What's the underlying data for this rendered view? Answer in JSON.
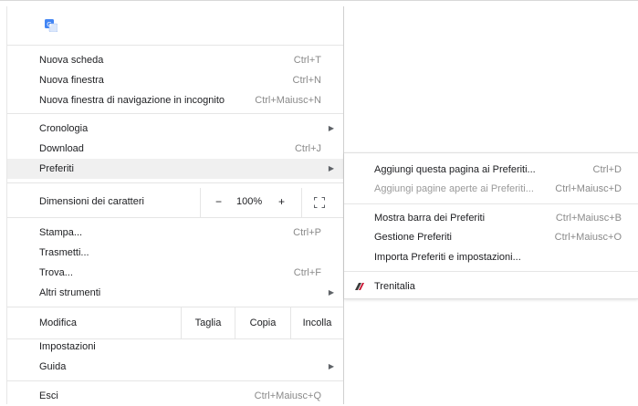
{
  "menu": {
    "new_tab": {
      "label": "Nuova scheda",
      "shortcut": "Ctrl+T"
    },
    "new_window": {
      "label": "Nuova finestra",
      "shortcut": "Ctrl+N"
    },
    "new_incognito": {
      "label": "Nuova finestra di navigazione in incognito",
      "shortcut": "Ctrl+Maiusc+N"
    },
    "history": {
      "label": "Cronologia"
    },
    "downloads": {
      "label": "Download",
      "shortcut": "Ctrl+J"
    },
    "bookmarks": {
      "label": "Preferiti"
    },
    "zoom": {
      "label": "Dimensioni dei caratteri",
      "minus": "−",
      "value": "100%",
      "plus": "+"
    },
    "print": {
      "label": "Stampa...",
      "shortcut": "Ctrl+P"
    },
    "cast": {
      "label": "Trasmetti..."
    },
    "find": {
      "label": "Trova...",
      "shortcut": "Ctrl+F"
    },
    "more_tools": {
      "label": "Altri strumenti"
    },
    "edit": {
      "label": "Modifica",
      "cut": "Taglia",
      "copy": "Copia",
      "paste": "Incolla"
    },
    "settings": {
      "label": "Impostazioni"
    },
    "help": {
      "label": "Guida"
    },
    "exit": {
      "label": "Esci",
      "shortcut": "Ctrl+Maiusc+Q"
    }
  },
  "submenu": {
    "add_bookmark": {
      "label": "Aggiungi questa pagina ai Preferiti...",
      "shortcut": "Ctrl+D"
    },
    "add_open_pages": {
      "label": "Aggiungi pagine aperte ai Preferiti...",
      "shortcut": "Ctrl+Maiusc+D"
    },
    "show_bar": {
      "label": "Mostra barra dei Preferiti",
      "shortcut": "Ctrl+Maiusc+B"
    },
    "manager": {
      "label": "Gestione Preferiti",
      "shortcut": "Ctrl+Maiusc+O"
    },
    "import": {
      "label": "Importa Preferiti e impostazioni..."
    },
    "bookmark_trenitalia": {
      "label": "Trenitalia"
    }
  },
  "colors": {
    "highlight": "#f0f0f0",
    "translate_blue": "#4285f4",
    "trenitalia_red": "#c8102e"
  },
  "icons": {
    "translate": "google-translate-icon",
    "submenu_arrow": "triangle-right-icon",
    "fullscreen": "fullscreen-icon",
    "bookmark_site": "trenitalia-favicon"
  }
}
